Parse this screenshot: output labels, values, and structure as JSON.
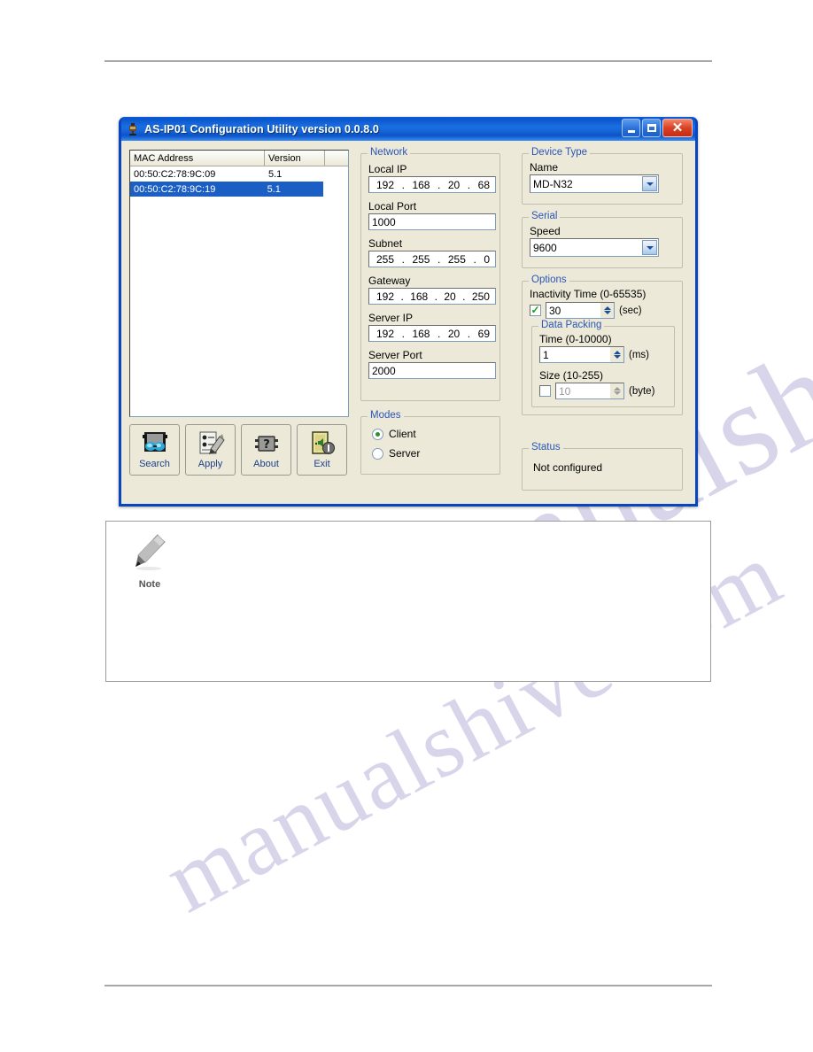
{
  "window": {
    "title": "AS-IP01  Configuration Utility version 0.0.8.0",
    "icon": "device-plug-icon",
    "minimize_label": "",
    "maximize_label": "",
    "close_label": "✕"
  },
  "device_list": {
    "columns": [
      "MAC Address",
      "Version",
      ""
    ],
    "rows": [
      {
        "mac": "00:50:C2:78:9C:09",
        "version": "5.1",
        "selected": false
      },
      {
        "mac": "00:50:C2:78:9C:19",
        "version": "5.1",
        "selected": true
      }
    ]
  },
  "toolbar": {
    "buttons": [
      {
        "label": "Search",
        "icon": "search-goggles-icon"
      },
      {
        "label": "Apply",
        "icon": "apply-pencil-icon"
      },
      {
        "label": "About",
        "icon": "about-question-icon"
      },
      {
        "label": "Exit",
        "icon": "exit-door-icon"
      }
    ]
  },
  "network": {
    "legend": "Network",
    "local_ip": {
      "label": "Local IP",
      "octets": [
        "192",
        "168",
        "20",
        "68"
      ]
    },
    "local_port": {
      "label": "Local Port",
      "value": "1000"
    },
    "subnet": {
      "label": "Subnet",
      "octets": [
        "255",
        "255",
        "255",
        "0"
      ]
    },
    "gateway": {
      "label": "Gateway",
      "octets": [
        "192",
        "168",
        "20",
        "250"
      ]
    },
    "server_ip": {
      "label": "Server IP",
      "octets": [
        "192",
        "168",
        "20",
        "69"
      ]
    },
    "server_port": {
      "label": "Server Port",
      "value": "2000"
    }
  },
  "modes": {
    "legend": "Modes",
    "options": [
      {
        "label": "Client",
        "selected": true
      },
      {
        "label": "Server",
        "selected": false
      }
    ]
  },
  "device_type": {
    "legend": "Device Type",
    "name_label": "Name",
    "name_value": "MD-N32"
  },
  "serial": {
    "legend": "Serial",
    "speed_label": "Speed",
    "speed_value": "9600"
  },
  "options": {
    "legend": "Options",
    "inactivity": {
      "label": "Inactivity Time (0-65535)",
      "checked": true,
      "value": "30",
      "unit": "(sec)"
    },
    "data_packing": {
      "legend": "Data Packing",
      "time": {
        "label": "Time (0-10000)",
        "value": "1",
        "unit": "(ms)"
      },
      "size": {
        "label": "Size (10-255)",
        "checked": false,
        "value": "10",
        "unit": "(byte)"
      }
    }
  },
  "status": {
    "legend": "Status",
    "text": "Not configured"
  },
  "note": {
    "label": "Note",
    "icon": "pencil-icon",
    "body": ""
  },
  "watermark": {
    "line1": "manualshive.com",
    "line2": "manualshive.com"
  },
  "colors": {
    "titlebar_blue": "#0a55cd",
    "window_face": "#ece9d8",
    "selection_blue": "#1c5fc4",
    "legend_blue": "#2a55b8",
    "label_link_blue": "#1b3f8b",
    "close_red": "#da4124"
  }
}
